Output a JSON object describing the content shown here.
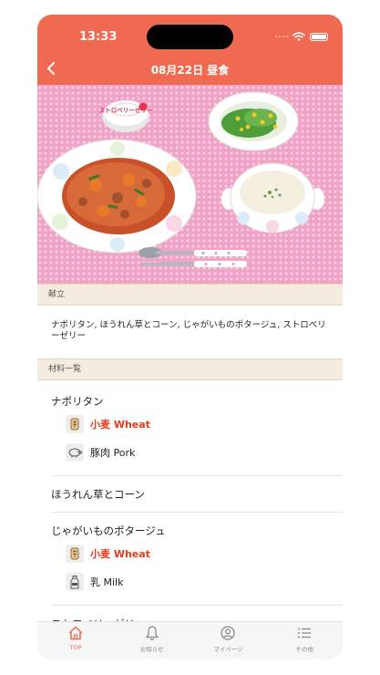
{
  "status_bar": {
    "time": "13:33"
  },
  "nav": {
    "title": "08月22日 昼食"
  },
  "photo": {
    "cup_label": "ストロベリーゼリー"
  },
  "sections": {
    "menu_header": "献立",
    "ingredients_header": "材料一覧"
  },
  "menu_description": "ナポリタン, ほうれん草とコーン, じゃがいものポタージュ, ストロベリーゼリー",
  "dishes": [
    {
      "name": "ナポリタン",
      "ingredients": [
        {
          "label": "小麦 Wheat",
          "icon": "wheat-icon",
          "allergen": true
        },
        {
          "label": "豚肉 Pork",
          "icon": "pig-icon",
          "allergen": false
        }
      ]
    },
    {
      "name": "ほうれん草とコーン",
      "ingredients": []
    },
    {
      "name": "じゃがいものポタージュ",
      "ingredients": [
        {
          "label": "小麦 Wheat",
          "icon": "wheat-icon",
          "allergen": true
        },
        {
          "label": "乳 Milk",
          "icon": "milk-bottle-icon",
          "allergen": false
        }
      ]
    },
    {
      "name": "ストロベリーゼリー",
      "ingredients": []
    }
  ],
  "tabbar": {
    "items": [
      {
        "label": "TOP",
        "icon": "home-icon",
        "active": true
      },
      {
        "label": "お知らせ",
        "icon": "bell-icon",
        "active": false
      },
      {
        "label": "マイページ",
        "icon": "user-icon",
        "active": false
      },
      {
        "label": "その他",
        "icon": "menu-list-icon",
        "active": false
      }
    ]
  },
  "colors": {
    "accent": "#ef6a50",
    "allergen": "#e23b1c",
    "section_bg": "#f5ece0",
    "photo_bg": "#f0a3c7"
  }
}
